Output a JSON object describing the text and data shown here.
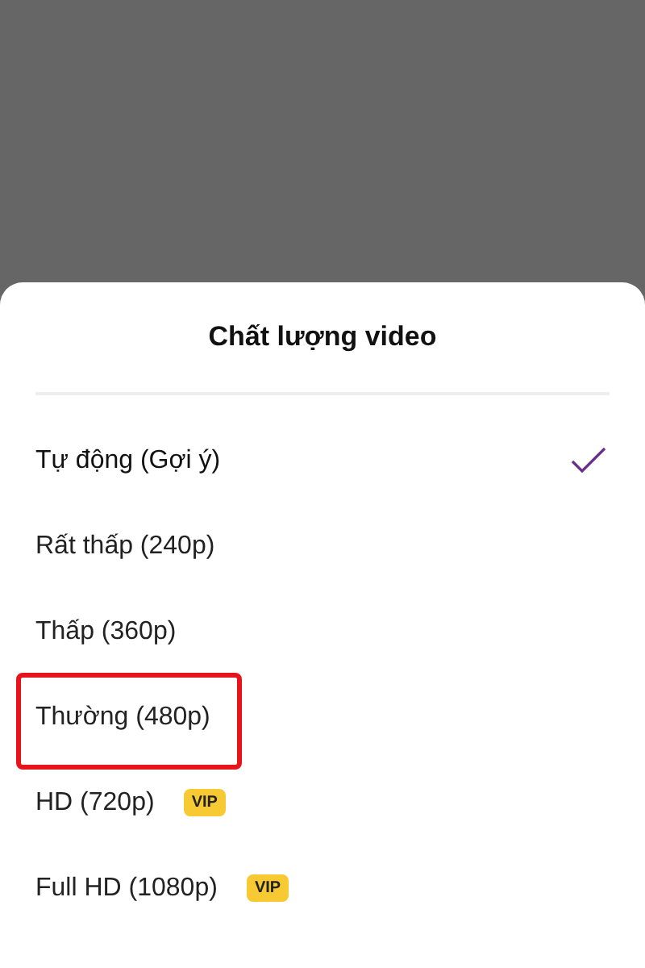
{
  "sheet": {
    "title": "Chất lượng video"
  },
  "options": [
    {
      "label": "Tự động (Gợi ý)",
      "selected": true,
      "highlighted": false
    },
    {
      "label": "Rất thấp (240p)",
      "selected": false,
      "highlighted": false
    },
    {
      "label": "Thấp (360p)",
      "selected": false,
      "highlighted": false
    },
    {
      "label": "Thường (480p)",
      "selected": false,
      "highlighted": true
    },
    {
      "label": "HD (720p)",
      "selected": false,
      "highlighted": false,
      "badge": "VIP"
    },
    {
      "label": "Full HD (1080p)",
      "selected": false,
      "highlighted": false,
      "badge": "VIP"
    }
  ]
}
